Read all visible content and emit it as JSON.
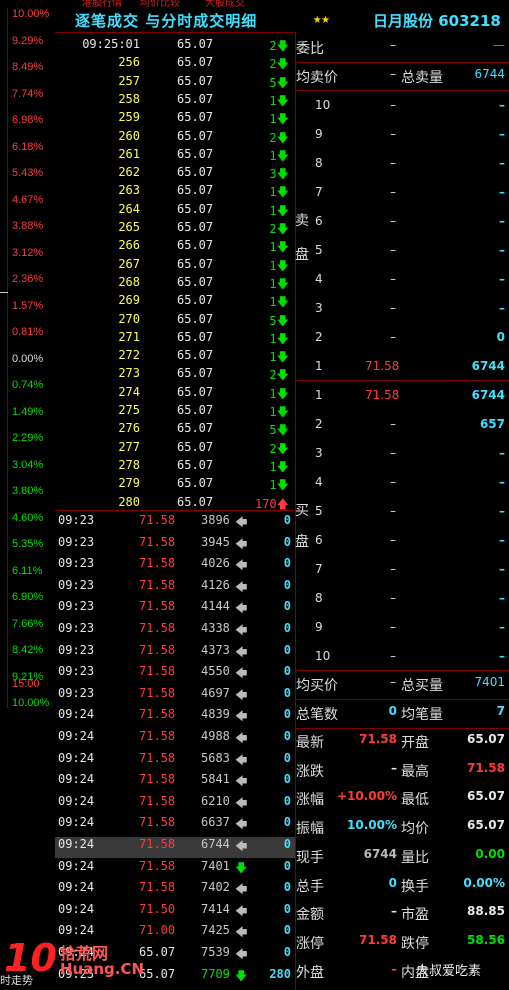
{
  "top_strip": [
    "港股行情",
    "均价比较",
    "大股成交"
  ],
  "header": {
    "title": "逐笔成交 与分时成交明细",
    "stars": "★★",
    "stock_name": "日月股份 603218"
  },
  "pct_axis": {
    "labels": [
      "10.00%",
      "9.29%",
      "8.49%",
      "7.74%",
      "6.98%",
      "6.18%",
      "5.43%",
      "4.67%",
      "3.88%",
      "3.12%",
      "2.36%",
      "1.57%",
      "0.81%",
      "0.00%",
      "0.74%",
      "1.49%",
      "2.29%",
      "3.04%",
      "3.80%",
      "4.60%",
      "5.35%",
      "6.11%",
      "6.90%",
      "7.66%",
      "8.42%",
      "9.21%",
      "10.00%"
    ],
    "time_label": "15:00",
    "bottom_label": "时走势"
  },
  "ticks": [
    {
      "seq": "09:25:01",
      "price": "65.07",
      "count": "2",
      "dir": "down"
    },
    {
      "seq": "256",
      "price": "65.07",
      "count": "2",
      "dir": "down"
    },
    {
      "seq": "257",
      "price": "65.07",
      "count": "5",
      "dir": "down"
    },
    {
      "seq": "258",
      "price": "65.07",
      "count": "1",
      "dir": "down"
    },
    {
      "seq": "259",
      "price": "65.07",
      "count": "1",
      "dir": "down"
    },
    {
      "seq": "260",
      "price": "65.07",
      "count": "2",
      "dir": "down"
    },
    {
      "seq": "261",
      "price": "65.07",
      "count": "1",
      "dir": "down"
    },
    {
      "seq": "262",
      "price": "65.07",
      "count": "3",
      "dir": "down"
    },
    {
      "seq": "263",
      "price": "65.07",
      "count": "1",
      "dir": "down"
    },
    {
      "seq": "264",
      "price": "65.07",
      "count": "1",
      "dir": "down"
    },
    {
      "seq": "265",
      "price": "65.07",
      "count": "2",
      "dir": "down"
    },
    {
      "seq": "266",
      "price": "65.07",
      "count": "1",
      "dir": "down"
    },
    {
      "seq": "267",
      "price": "65.07",
      "count": "1",
      "dir": "down"
    },
    {
      "seq": "268",
      "price": "65.07",
      "count": "1",
      "dir": "down"
    },
    {
      "seq": "269",
      "price": "65.07",
      "count": "1",
      "dir": "down"
    },
    {
      "seq": "270",
      "price": "65.07",
      "count": "5",
      "dir": "down"
    },
    {
      "seq": "271",
      "price": "65.07",
      "count": "1",
      "dir": "down"
    },
    {
      "seq": "272",
      "price": "65.07",
      "count": "1",
      "dir": "down"
    },
    {
      "seq": "273",
      "price": "65.07",
      "count": "2",
      "dir": "down"
    },
    {
      "seq": "274",
      "price": "65.07",
      "count": "1",
      "dir": "down"
    },
    {
      "seq": "275",
      "price": "65.07",
      "count": "1",
      "dir": "down"
    },
    {
      "seq": "276",
      "price": "65.07",
      "count": "5",
      "dir": "down"
    },
    {
      "seq": "277",
      "price": "65.07",
      "count": "2",
      "dir": "down"
    },
    {
      "seq": "278",
      "price": "65.07",
      "count": "1",
      "dir": "down"
    },
    {
      "seq": "279",
      "price": "65.07",
      "count": "1",
      "dir": "down"
    },
    {
      "seq": "280",
      "price": "65.07",
      "count": "170",
      "dir": "up"
    }
  ],
  "trades": [
    {
      "time": "09:23",
      "price": "71.58",
      "vol": "3896",
      "dir": "left",
      "num": "0"
    },
    {
      "time": "09:23",
      "price": "71.58",
      "vol": "3945",
      "dir": "left",
      "num": "0"
    },
    {
      "time": "09:23",
      "price": "71.58",
      "vol": "4026",
      "dir": "left",
      "num": "0"
    },
    {
      "time": "09:23",
      "price": "71.58",
      "vol": "4126",
      "dir": "left",
      "num": "0"
    },
    {
      "time": "09:23",
      "price": "71.58",
      "vol": "4144",
      "dir": "left",
      "num": "0"
    },
    {
      "time": "09:23",
      "price": "71.58",
      "vol": "4338",
      "dir": "left",
      "num": "0"
    },
    {
      "time": "09:23",
      "price": "71.58",
      "vol": "4373",
      "dir": "left",
      "num": "0"
    },
    {
      "time": "09:23",
      "price": "71.58",
      "vol": "4550",
      "dir": "left",
      "num": "0"
    },
    {
      "time": "09:23",
      "price": "71.58",
      "vol": "4697",
      "dir": "left",
      "num": "0"
    },
    {
      "time": "09:24",
      "price": "71.58",
      "vol": "4839",
      "dir": "left",
      "num": "0"
    },
    {
      "time": "09:24",
      "price": "71.58",
      "vol": "4988",
      "dir": "left",
      "num": "0"
    },
    {
      "time": "09:24",
      "price": "71.58",
      "vol": "5683",
      "dir": "left",
      "num": "0"
    },
    {
      "time": "09:24",
      "price": "71.58",
      "vol": "5841",
      "dir": "left",
      "num": "0"
    },
    {
      "time": "09:24",
      "price": "71.58",
      "vol": "6210",
      "dir": "left",
      "num": "0"
    },
    {
      "time": "09:24",
      "price": "71.58",
      "vol": "6637",
      "dir": "left",
      "num": "0"
    },
    {
      "time": "09:24",
      "price": "71.58",
      "vol": "6744",
      "dir": "left",
      "num": "0",
      "highlight": true
    },
    {
      "time": "09:24",
      "price": "71.58",
      "vol": "7401",
      "dir": "down",
      "num": "0"
    },
    {
      "time": "09:24",
      "price": "71.58",
      "vol": "7402",
      "dir": "left",
      "num": "0"
    },
    {
      "time": "09:24",
      "price": "71.50",
      "vol": "7414",
      "dir": "left",
      "num": "0"
    },
    {
      "time": "09:24",
      "price": "71.00",
      "vol": "7425",
      "dir": "left",
      "num": "0"
    },
    {
      "time": "09:24",
      "price": "65.07",
      "vol": "7539",
      "dir": "left",
      "num": "0"
    },
    {
      "time": "09:25",
      "price": "65.07",
      "vol": "7709",
      "dir": "down",
      "num": "280"
    }
  ],
  "right": {
    "weibi_label": "委比",
    "weibi_value": "–",
    "weibi_value2": "—",
    "avg_sell_label": "均卖价",
    "avg_sell_value": "–",
    "total_sell_label": "总卖量",
    "total_sell_value": "6744",
    "sell_side_label": [
      "卖",
      "盘"
    ],
    "sell_levels": [
      {
        "lvl": "10",
        "price": "–",
        "vol": "–"
      },
      {
        "lvl": "9",
        "price": "–",
        "vol": "–"
      },
      {
        "lvl": "8",
        "price": "–",
        "vol": "–"
      },
      {
        "lvl": "7",
        "price": "–",
        "vol": "–"
      },
      {
        "lvl": "6",
        "price": "–",
        "vol": "–"
      },
      {
        "lvl": "5",
        "price": "–",
        "vol": "–"
      },
      {
        "lvl": "4",
        "price": "–",
        "vol": "–"
      },
      {
        "lvl": "3",
        "price": "–",
        "vol": "–"
      },
      {
        "lvl": "2",
        "price": "–",
        "vol": "0"
      },
      {
        "lvl": "1",
        "price": "71.58",
        "vol": "6744"
      }
    ],
    "buy_side_label": [
      "买",
      "盘"
    ],
    "buy_levels": [
      {
        "lvl": "1",
        "price": "71.58",
        "vol": "6744"
      },
      {
        "lvl": "2",
        "price": "–",
        "vol": "657"
      },
      {
        "lvl": "3",
        "price": "–",
        "vol": "–"
      },
      {
        "lvl": "4",
        "price": "–",
        "vol": "–"
      },
      {
        "lvl": "5",
        "price": "–",
        "vol": "–"
      },
      {
        "lvl": "6",
        "price": "–",
        "vol": "–"
      },
      {
        "lvl": "7",
        "price": "–",
        "vol": "–"
      },
      {
        "lvl": "8",
        "price": "–",
        "vol": "–"
      },
      {
        "lvl": "9",
        "price": "–",
        "vol": "–"
      },
      {
        "lvl": "10",
        "price": "–",
        "vol": "–"
      }
    ],
    "avg_buy_label": "均买价",
    "avg_buy_value": "–",
    "total_buy_label": "总买量",
    "total_buy_value": "7401",
    "total_trades_label": "总笔数",
    "total_trades_value": "0",
    "avg_per_trade_label": "均笔量",
    "avg_per_trade_value": "7",
    "stats": [
      {
        "l1": "最新",
        "v1": "71.58",
        "c1": "red",
        "l2": "开盘",
        "v2": "65.07",
        "c2": "wht"
      },
      {
        "l1": "涨跌",
        "v1": "–",
        "c1": "wht",
        "l2": "最高",
        "v2": "71.58",
        "c2": "red"
      },
      {
        "l1": "涨幅",
        "v1": "+10.00%",
        "c1": "red",
        "l2": "最低",
        "v2": "65.07",
        "c2": "wht"
      },
      {
        "l1": "振幅",
        "v1": "10.00%",
        "c1": "cyn",
        "l2": "均价",
        "v2": "65.07",
        "c2": "wht"
      },
      {
        "l1": "现手",
        "v1": "6744",
        "c1": "gry",
        "l2": "量比",
        "v2": "0.00",
        "c2": "grn"
      },
      {
        "l1": "总手",
        "v1": "0",
        "c1": "cyn",
        "l2": "换手",
        "v2": "0.00%",
        "c2": "cyn"
      },
      {
        "l1": "金额",
        "v1": "–",
        "c1": "wht",
        "l2": "市盈",
        "v2": "88.85",
        "c2": "wht"
      },
      {
        "l1": "涨停",
        "v1": "71.58",
        "c1": "red",
        "l2": "跌停",
        "v2": "58.56",
        "c2": "grn"
      },
      {
        "l1": "外盘",
        "v1": "–",
        "c1": "red",
        "l2": "内盘",
        "v2": "",
        "c2": "wht"
      }
    ]
  },
  "watermark": {
    "logo": "10",
    "site": "拾荒网",
    "domain": "Huang.CN",
    "author": "大叔爱吃素"
  },
  "colors": {
    "red": "#ff3b3b",
    "green": "#00e000",
    "yellow": "#ffff55",
    "cyan": "#40e0ff",
    "grid": "#800000"
  }
}
